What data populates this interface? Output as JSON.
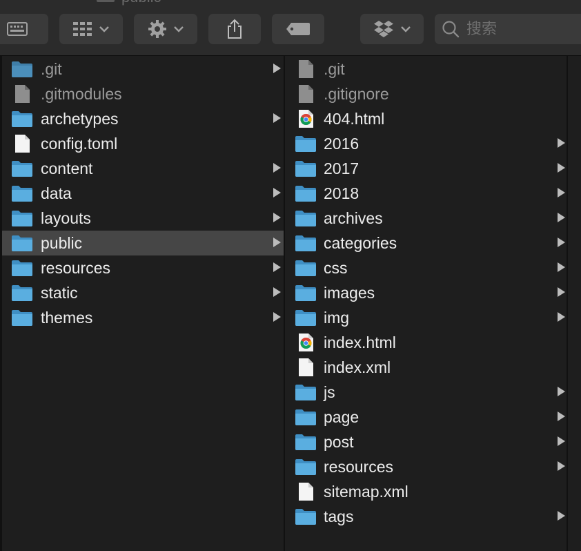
{
  "window": {
    "title": "public"
  },
  "toolbar": {
    "search_placeholder": "搜索"
  },
  "column1": [
    {
      "name": ".git",
      "type": "folder",
      "hidden": true,
      "arrow": true
    },
    {
      "name": ".gitmodules",
      "type": "file",
      "hidden": true,
      "arrow": false
    },
    {
      "name": "archetypes",
      "type": "folder",
      "hidden": false,
      "arrow": true
    },
    {
      "name": "config.toml",
      "type": "file",
      "hidden": false,
      "arrow": false
    },
    {
      "name": "content",
      "type": "folder",
      "hidden": false,
      "arrow": true
    },
    {
      "name": "data",
      "type": "folder",
      "hidden": false,
      "arrow": true
    },
    {
      "name": "layouts",
      "type": "folder",
      "hidden": false,
      "arrow": true
    },
    {
      "name": "public",
      "type": "folder",
      "hidden": false,
      "arrow": true,
      "selected": true
    },
    {
      "name": "resources",
      "type": "folder",
      "hidden": false,
      "arrow": true
    },
    {
      "name": "static",
      "type": "folder",
      "hidden": false,
      "arrow": true
    },
    {
      "name": "themes",
      "type": "folder",
      "hidden": false,
      "arrow": true
    }
  ],
  "column2": [
    {
      "name": ".git",
      "type": "file",
      "hidden": true,
      "arrow": false
    },
    {
      "name": ".gitignore",
      "type": "file",
      "hidden": true,
      "arrow": false
    },
    {
      "name": "404.html",
      "type": "chrome",
      "hidden": false,
      "arrow": false
    },
    {
      "name": "2016",
      "type": "folder",
      "hidden": false,
      "arrow": true
    },
    {
      "name": "2017",
      "type": "folder",
      "hidden": false,
      "arrow": true
    },
    {
      "name": "2018",
      "type": "folder",
      "hidden": false,
      "arrow": true
    },
    {
      "name": "archives",
      "type": "folder",
      "hidden": false,
      "arrow": true
    },
    {
      "name": "categories",
      "type": "folder",
      "hidden": false,
      "arrow": true
    },
    {
      "name": "css",
      "type": "folder",
      "hidden": false,
      "arrow": true
    },
    {
      "name": "images",
      "type": "folder",
      "hidden": false,
      "arrow": true
    },
    {
      "name": "img",
      "type": "folder",
      "hidden": false,
      "arrow": true
    },
    {
      "name": "index.html",
      "type": "chrome",
      "hidden": false,
      "arrow": false
    },
    {
      "name": "index.xml",
      "type": "file",
      "hidden": false,
      "arrow": false
    },
    {
      "name": "js",
      "type": "folder",
      "hidden": false,
      "arrow": true
    },
    {
      "name": "page",
      "type": "folder",
      "hidden": false,
      "arrow": true
    },
    {
      "name": "post",
      "type": "folder",
      "hidden": false,
      "arrow": true
    },
    {
      "name": "resources",
      "type": "folder",
      "hidden": false,
      "arrow": true
    },
    {
      "name": "sitemap.xml",
      "type": "file",
      "hidden": false,
      "arrow": false
    },
    {
      "name": "tags",
      "type": "folder",
      "hidden": false,
      "arrow": true
    }
  ],
  "colors": {
    "folder_blue": "#5aaee0",
    "folder_blue_dark": "#3f8fc4",
    "selection": "#464646",
    "background": "#1e1e1e"
  }
}
